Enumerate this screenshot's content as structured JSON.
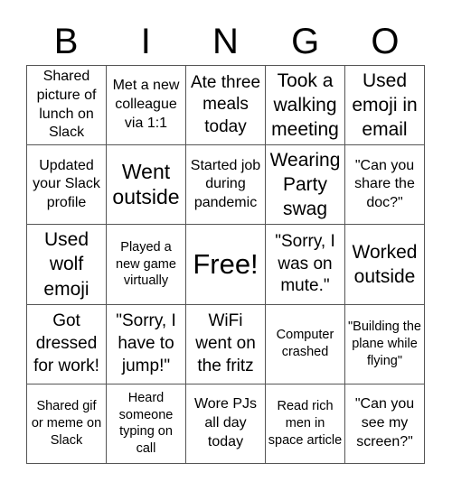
{
  "header": [
    "B",
    "I",
    "N",
    "G",
    "O"
  ],
  "cells": [
    "Shared picture of lunch on Slack",
    "Met a new colleague via 1:1",
    "Ate three meals today",
    "Took a walking meeting",
    "Used emoji in email",
    "Updated your Slack profile",
    "Went outside",
    "Started job during pandemic",
    "Wearing Party swag",
    "\"Can you share the doc?\"",
    "Used wolf emoji",
    "Played a new game virtually",
    "Free!",
    "\"Sorry, I was on mute.\"",
    "Worked outside",
    "Got dressed for work!",
    "\"Sorry, I have to jump!\"",
    "WiFi went on the fritz",
    "Computer crashed",
    "\"Building the plane while flying\"",
    "Shared gif or meme on Slack",
    "Heard someone typing on call",
    "Wore PJs all day today",
    "Read rich men in space article",
    "\"Can you see my screen?\""
  ]
}
